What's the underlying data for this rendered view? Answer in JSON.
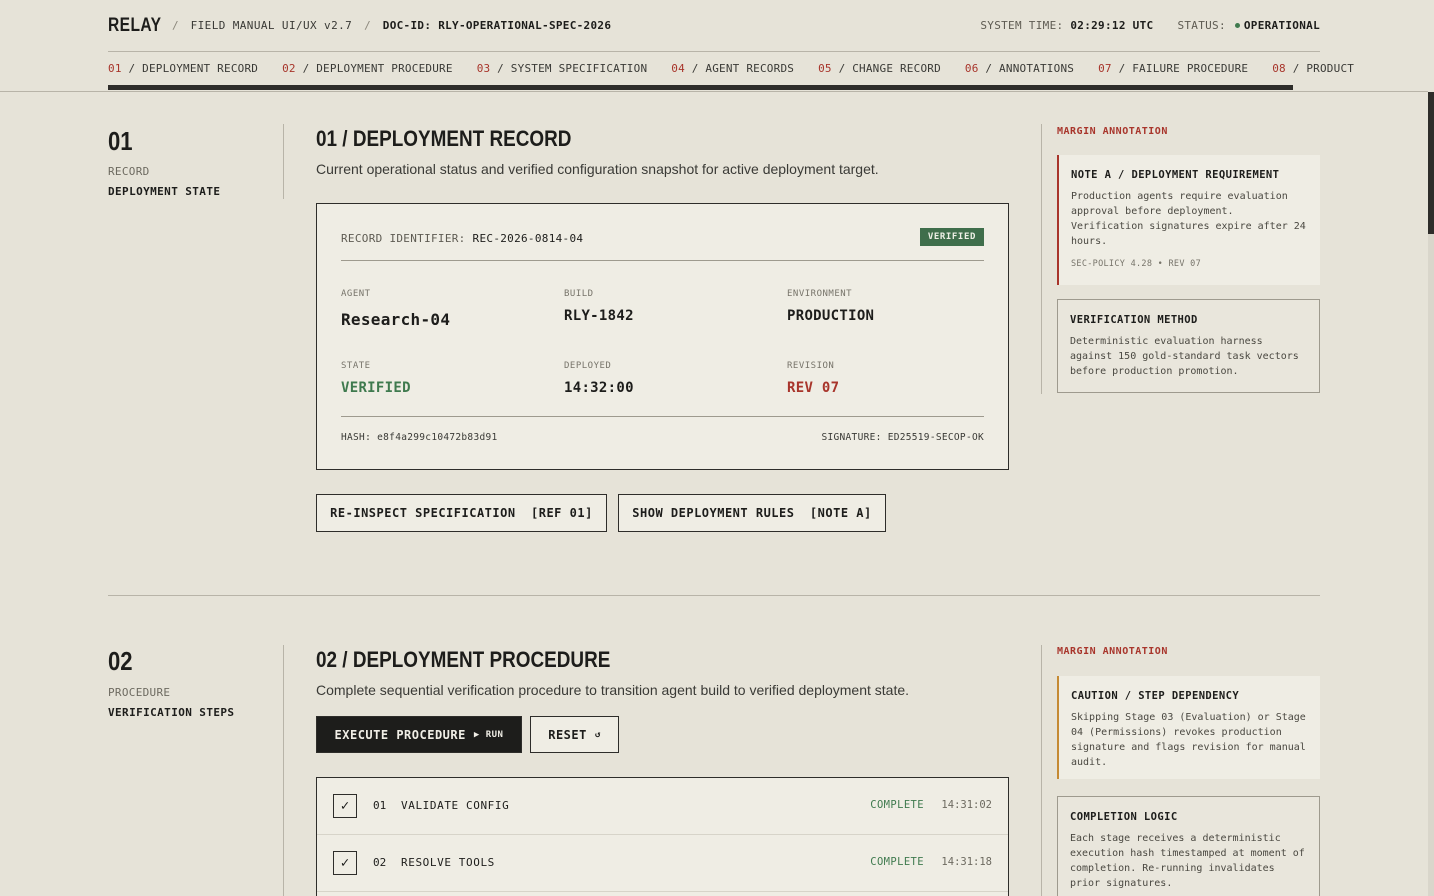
{
  "header": {
    "brand": "RELAY",
    "manual": "FIELD MANUAL UI/UX v2.7",
    "doc_prefix": "DOC-ID:",
    "doc_id": "RLY-OPERATIONAL-SPEC-2026",
    "time_label": "SYSTEM TIME:",
    "time_value": "02:29:12 UTC",
    "status_label": "STATUS:",
    "status_value": "OPERATIONAL"
  },
  "nav": [
    {
      "num": "01",
      "label": " / DEPLOYMENT RECORD"
    },
    {
      "num": "02",
      "label": " / DEPLOYMENT PROCEDURE"
    },
    {
      "num": "03",
      "label": " / SYSTEM SPECIFICATION"
    },
    {
      "num": "04",
      "label": " / AGENT RECORDS"
    },
    {
      "num": "05",
      "label": " / CHANGE RECORD"
    },
    {
      "num": "06",
      "label": " / ANNOTATIONS"
    },
    {
      "num": "07",
      "label": " / FAILURE PROCEDURE"
    },
    {
      "num": "08",
      "label": " / PRODUCT"
    }
  ],
  "section1": {
    "num": "01",
    "kind": "RECORD",
    "sub": "DEPLOYMENT STATE",
    "title": "01 / DEPLOYMENT RECORD",
    "desc": "Current operational status and verified configuration snapshot for active deployment target.",
    "record_label": "RECORD IDENTIFIER:",
    "record_id": "REC-2026-0814-04",
    "badge": "VERIFIED",
    "fields": {
      "agent_label": "AGENT",
      "agent": "Research-04",
      "build_label": "BUILD",
      "build": "RLY-1842",
      "env_label": "ENVIRONMENT",
      "env": "PRODUCTION",
      "state_label": "STATE",
      "state": "VERIFIED",
      "deployed_label": "DEPLOYED",
      "deployed": "14:32:00",
      "revision_label": "REVISION",
      "revision": "REV 07"
    },
    "hash_label": "HASH:",
    "hash": "e8f4a299c10472b83d91",
    "sig_label": "SIGNATURE:",
    "sig": "ED25519-SECOP-OK",
    "btn_inspect": "RE-INSPECT SPECIFICATION  [REF 01]",
    "btn_rules": "SHOW DEPLOYMENT RULES  [NOTE A]",
    "ann_head": "MARGIN ANNOTATION",
    "note_a_title": "NOTE A / DEPLOYMENT REQUIREMENT",
    "note_a_body": "Production agents require evaluation approval before deployment. Verification signatures expire after 24 hours.",
    "note_a_meta": "SEC-POLICY 4.28 • REV 07",
    "note_b_title": "VERIFICATION METHOD",
    "note_b_body": "Deterministic evaluation harness against 150 gold-standard task vectors before production promotion."
  },
  "section2": {
    "num": "02",
    "kind": "PROCEDURE",
    "sub": "VERIFICATION STEPS",
    "title": "02 / DEPLOYMENT PROCEDURE",
    "desc": "Complete sequential verification procedure to transition agent build to verified deployment state.",
    "btn_execute": "EXECUTE PROCEDURE",
    "btn_execute_tag": "▶ RUN",
    "btn_reset": "RESET",
    "btn_reset_icon": "↺",
    "steps": [
      {
        "num": "01",
        "name": "VALIDATE CONFIG",
        "status": "COMPLETE",
        "time": "14:31:02",
        "mark": "✓"
      },
      {
        "num": "02",
        "name": "RESOLVE TOOLS",
        "status": "COMPLETE",
        "time": "14:31:18",
        "mark": "✓"
      }
    ],
    "ann_head": "MARGIN ANNOTATION",
    "caution_title": "CAUTION / STEP DEPENDENCY",
    "caution_body": "Skipping Stage 03 (Evaluation) or Stage 04 (Permissions) revokes production signature and flags revision for manual audit.",
    "logic_title": "COMPLETION LOGIC",
    "logic_body": "Each stage receives a deterministic execution hash timestamped at moment of completion. Re-running invalidates prior signatures."
  }
}
